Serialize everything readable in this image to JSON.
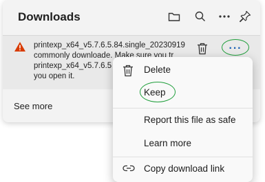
{
  "header": {
    "title": "Downloads",
    "icons": [
      "folder-icon",
      "search-icon",
      "more-horizontal-icon",
      "pin-icon"
    ]
  },
  "download_item": {
    "filename": "printexp_x64_v5.7.6.5.84.single_20230919",
    "line2": "commonly downloade. Make sure you tr",
    "line3": "printexp_x64_v5.7.6.5",
    "line4": "you open it.",
    "more_label": "···"
  },
  "see_more": "See more",
  "context_menu": {
    "delete": "Delete",
    "keep": "Keep",
    "report": "Report this file as safe",
    "learn_more": "Learn more",
    "copy_link": "Copy download link"
  },
  "colors": {
    "accent": "#1a5fb4",
    "annotation": "#1e9e3a",
    "warning": "#d83b01"
  }
}
